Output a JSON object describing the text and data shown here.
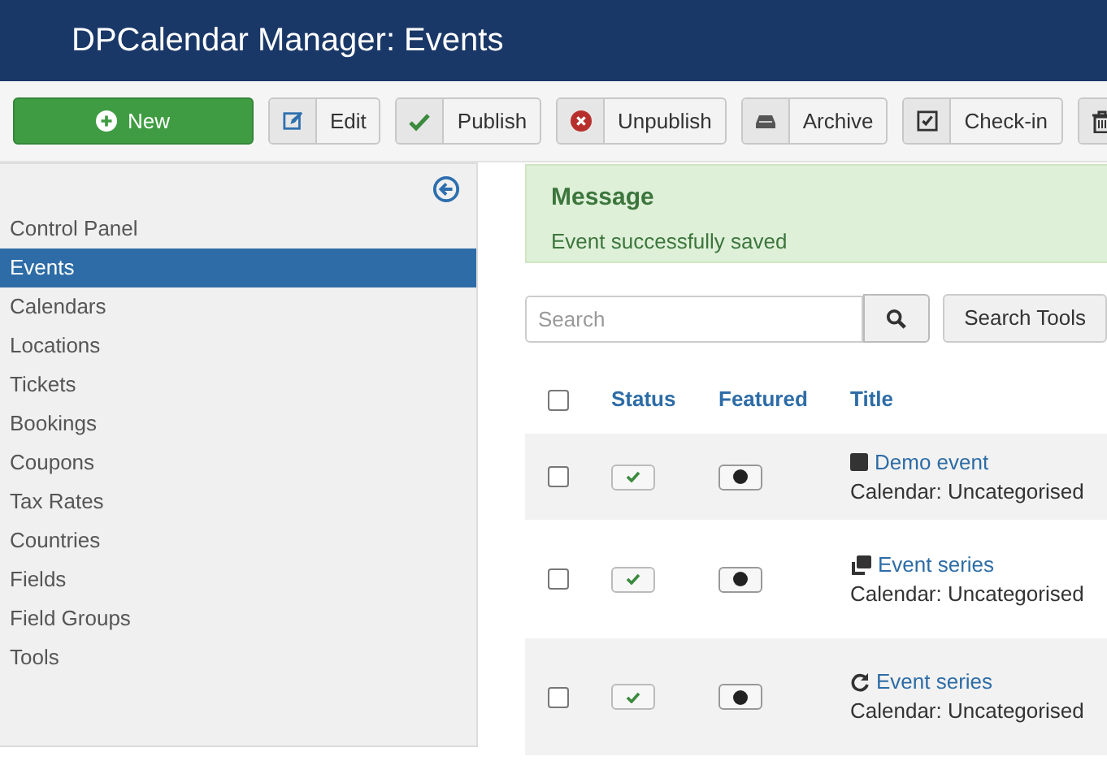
{
  "header": {
    "title": "DPCalendar Manager: Events"
  },
  "toolbar": [
    {
      "kind": "new",
      "label": "New"
    },
    {
      "kind": "edit",
      "label": "Edit"
    },
    {
      "kind": "publish",
      "label": "Publish"
    },
    {
      "kind": "unpublish",
      "label": "Unpublish"
    },
    {
      "kind": "archive",
      "label": "Archive"
    },
    {
      "kind": "checkin",
      "label": "Check-in"
    },
    {
      "kind": "trash"
    }
  ],
  "sidebar": {
    "items": [
      {
        "label": "Control Panel",
        "selected": false
      },
      {
        "label": "Events",
        "selected": true
      },
      {
        "label": "Calendars",
        "selected": false
      },
      {
        "label": "Locations",
        "selected": false
      },
      {
        "label": "Tickets",
        "selected": false
      },
      {
        "label": "Bookings",
        "selected": false
      },
      {
        "label": "Coupons",
        "selected": false
      },
      {
        "label": "Tax Rates",
        "selected": false
      },
      {
        "label": "Countries",
        "selected": false
      },
      {
        "label": "Fields",
        "selected": false
      },
      {
        "label": "Field Groups",
        "selected": false
      },
      {
        "label": "Tools",
        "selected": false
      }
    ]
  },
  "message": {
    "heading": "Message",
    "text": "Event successfully saved"
  },
  "search": {
    "placeholder": "Search",
    "tools_label": "Search Tools"
  },
  "table": {
    "select_all_checked": false,
    "columns": [
      "Status",
      "Featured",
      "Title"
    ],
    "rows": [
      {
        "kind": "single",
        "title": "Demo event",
        "calendar": "Calendar: Uncategorised",
        "checked": false,
        "published": true,
        "featured": true
      },
      {
        "kind": "series",
        "title": "Event series",
        "calendar": "Calendar: Uncategorised",
        "checked": false,
        "published": true,
        "featured": true
      },
      {
        "kind": "recurring",
        "title": "Event series",
        "calendar": "Calendar: Uncategorised",
        "checked": false,
        "published": true,
        "featured": true
      }
    ]
  }
}
